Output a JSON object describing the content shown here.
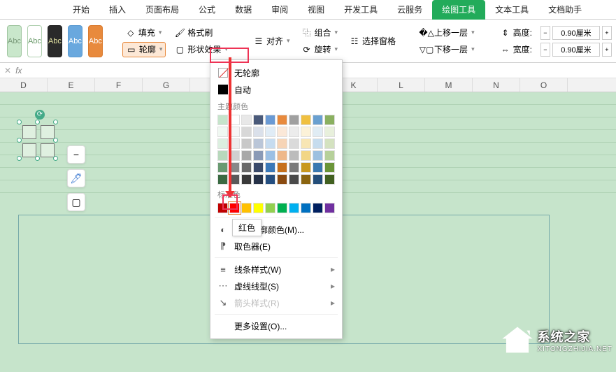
{
  "tabs": [
    "开始",
    "插入",
    "页面布局",
    "公式",
    "数据",
    "审阅",
    "视图",
    "开发工具",
    "云服务",
    "绘图工具",
    "文本工具",
    "文档助手"
  ],
  "active_tab_index": 9,
  "ribbon": {
    "swatch_label": "Abc",
    "fill": "填充",
    "outline": "轮廓",
    "format_painter": "格式刷",
    "shape_effects": "形状效果",
    "align": "对齐",
    "group": "组合",
    "rotate": "旋转",
    "selection_pane": "选择窗格",
    "bring_forward": "上移一层",
    "send_backward": "下移一层",
    "height_label": "高度:",
    "width_label": "宽度:",
    "height_value": "0.90厘米",
    "width_value": "0.90厘米"
  },
  "columns": [
    "D",
    "E",
    "F",
    "G",
    "",
    "",
    "",
    "K",
    "L",
    "M",
    "N",
    "O"
  ],
  "popup": {
    "no_outline": "无轮廓",
    "auto": "自动",
    "theme_colors": "主题颜色",
    "standard_colors": "标准色",
    "more_colors": "其他轮廓颜色(M)...",
    "eyedropper": "取色器(E)",
    "line_style": "线条样式(W)",
    "dash_style": "虚线线型(S)",
    "arrow_style": "箭头样式(R)",
    "more_settings": "更多设置(O)...",
    "theme_palette": [
      [
        "#c6e4cb",
        "#ffffff",
        "#e8e8e8",
        "#4a5a7a",
        "#6a9ad4",
        "#e88a3d",
        "#a0a0a0",
        "#f0c040",
        "#6aa0d0",
        "#8ab060"
      ],
      [
        "#f0f8f2",
        "#f6f6f6",
        "#d8d8d8",
        "#dae0ea",
        "#e0ecf6",
        "#fbe8d8",
        "#ececec",
        "#fcf2d8",
        "#e0ecf4",
        "#e8f0dc"
      ],
      [
        "#dcefe0",
        "#ececec",
        "#c8c8c8",
        "#bac6d8",
        "#c6dcf0",
        "#f6d4b6",
        "#dadada",
        "#f8e6b4",
        "#c6dcee",
        "#d4e2c0"
      ],
      [
        "#b8d8bc",
        "#d0d0d0",
        "#a8a8a8",
        "#8a9ab6",
        "#9cc0e4",
        "#eeb88a",
        "#bcbcbc",
        "#f2d686",
        "#9cc0e0",
        "#b6d09a"
      ],
      [
        "#6a9a72",
        "#888888",
        "#6a6a6a",
        "#3a4a6a",
        "#3a78b8",
        "#c6701c",
        "#7a7a7a",
        "#c89820",
        "#3a78b0",
        "#6a9438"
      ],
      [
        "#3a6a42",
        "#5a5a5a",
        "#3a3a3a",
        "#263248",
        "#244e80",
        "#8a4a10",
        "#4a4a4a",
        "#8a6410",
        "#244e7a",
        "#426020"
      ]
    ],
    "standard_palette": [
      "#c00000",
      "#ff0000",
      "#ffc000",
      "#ffff00",
      "#92d050",
      "#00b050",
      "#00b0f0",
      "#0070c0",
      "#002060",
      "#7030a0"
    ]
  },
  "tooltip": "红色",
  "watermark": {
    "title": "系统之家",
    "sub": "XITONGZHIJIA.NET"
  }
}
